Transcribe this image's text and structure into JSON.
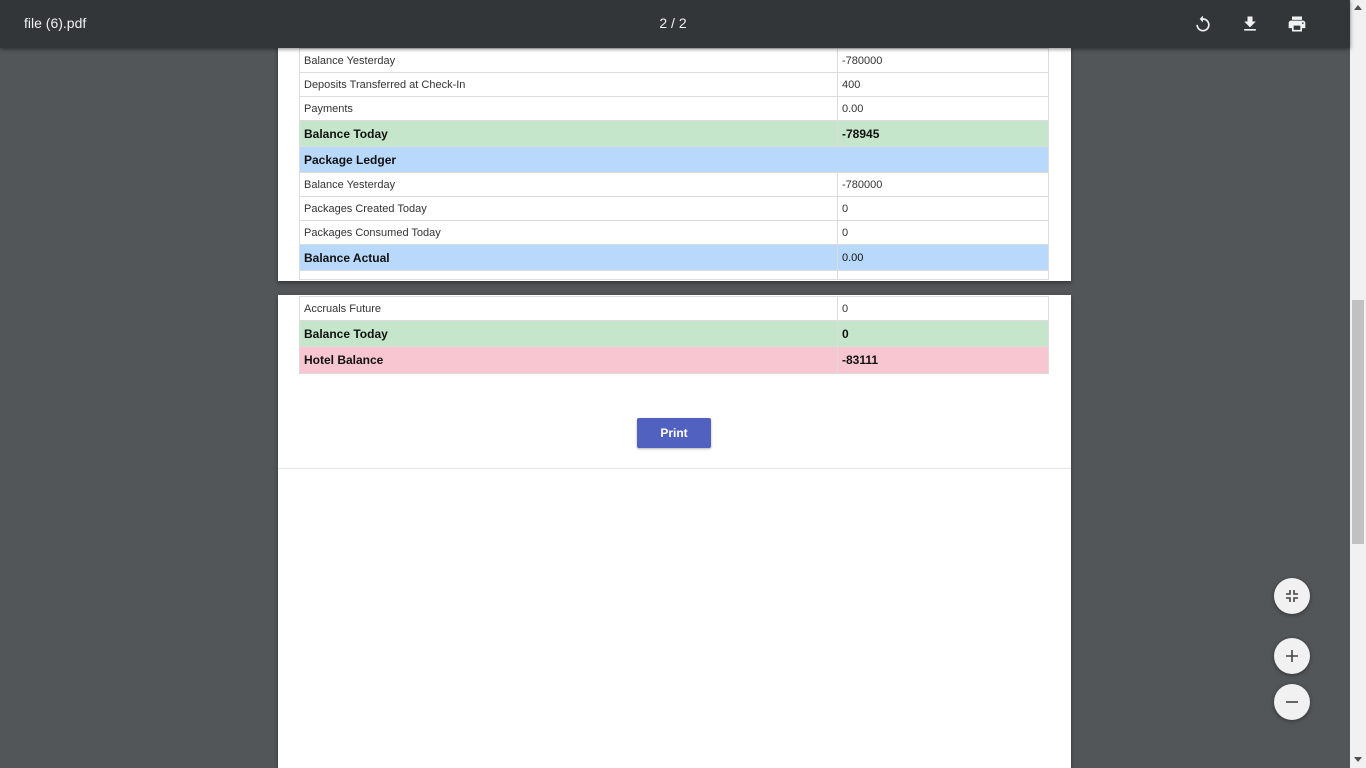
{
  "toolbar": {
    "file_name": "file (6).pdf",
    "page_indicator": "2 / 2",
    "rotate_icon": "rotate-icon",
    "download_icon": "download-icon",
    "print_icon": "print-icon"
  },
  "page1_rows": [
    {
      "label": "Balance Yesterday",
      "value": "-780000"
    },
    {
      "label": "Deposits Transferred at Check-In",
      "value": "400"
    },
    {
      "label": "Payments",
      "value": "0.00"
    },
    {
      "label": "Balance Today",
      "value": "-78945"
    },
    {
      "label": "Package Ledger",
      "value": ""
    },
    {
      "label": "Balance Yesterday",
      "value": "-780000"
    },
    {
      "label": "Packages Created Today",
      "value": "0"
    },
    {
      "label": "Packages Consumed Today",
      "value": "0"
    },
    {
      "label": "Balance Actual",
      "value": "0.00"
    }
  ],
  "page2_rows": [
    {
      "label": "Accruals Future",
      "value": "0"
    },
    {
      "label": "Balance Today",
      "value": "0"
    },
    {
      "label": "Hotel Balance",
      "value": "-83111"
    }
  ],
  "print_button": {
    "label": "Print"
  },
  "zoom": {
    "fit_icon": "fit-to-page-icon",
    "zoom_in_icon": "zoom-in-icon",
    "zoom_out_icon": "zoom-out-icon"
  },
  "colors": {
    "toolbar": "#323639",
    "viewer_background": "#525659",
    "green_row": "#c6e6cb",
    "blue_row": "#b8d9fb",
    "pink_row": "#f7c6d0",
    "print_button": "#5061c0"
  }
}
